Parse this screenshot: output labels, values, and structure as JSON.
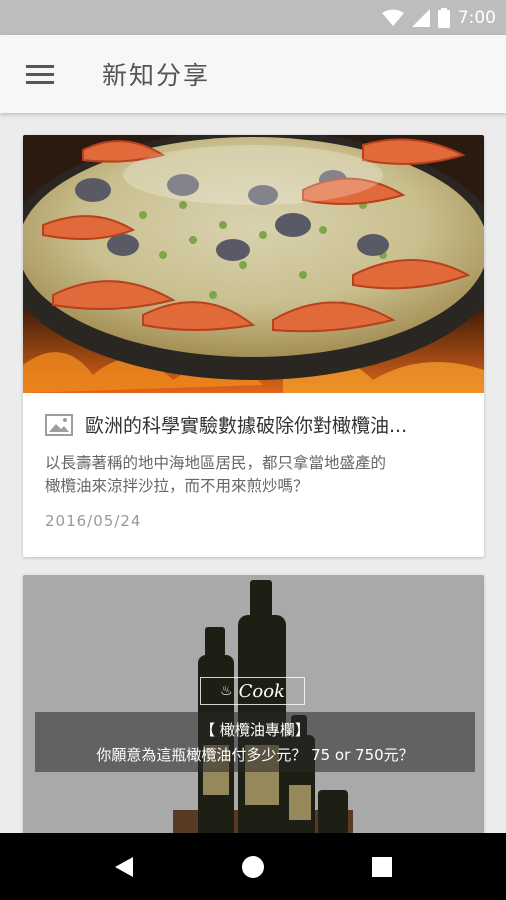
{
  "status_bar": {
    "time": "7:00",
    "icons": [
      "wifi-icon",
      "cellular-signal-icon",
      "battery-icon"
    ]
  },
  "app_bar": {
    "menu_icon": "hamburger-menu-icon",
    "title": "新知分享"
  },
  "feed": {
    "articles": [
      {
        "image": "seafood paella in pan over fire",
        "type_icon": "image-icon",
        "title": "歐洲的科學實驗數據破除你對橄欖油...",
        "excerpt_line1": "以長壽著稱的地中海地區居民，都只拿當地盛產的",
        "excerpt_line2": "橄欖油來涼拌沙拉，而不用來煎炒嗎？",
        "date": "2016/05/24"
      },
      {
        "image": "olive oil bottles",
        "badge": "Cook",
        "overlay_title": "【 橄欖油專欄】",
        "overlay_subtitle": "你願意為這瓶橄欖油付多少元？ 75 or 750元？"
      }
    ]
  },
  "nav_bar": {
    "buttons": [
      "back-icon",
      "home-icon",
      "recents-icon"
    ]
  },
  "colors": {
    "status_bar": "#bdbdbd",
    "app_bar": "#f7f7f7",
    "background": "#ececec",
    "nav_bar": "#000000"
  }
}
